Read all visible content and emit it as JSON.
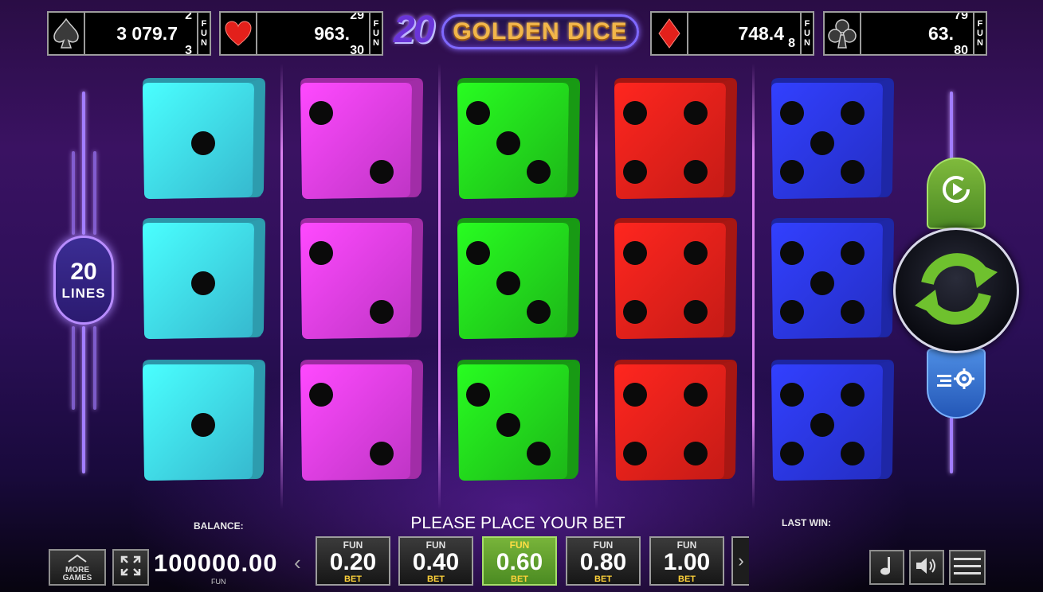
{
  "jackpots": [
    {
      "suit": "spade",
      "icon": "spade-icon",
      "value": "3 079.7",
      "roll_top": "2",
      "roll_bottom": "3",
      "fun": "FUN"
    },
    {
      "suit": "heart",
      "icon": "heart-icon",
      "value": "963.",
      "roll_top": "29",
      "roll_bottom": "30",
      "fun": "FUN"
    },
    {
      "suit": "diamond",
      "icon": "diamond-icon",
      "value": "748.4",
      "roll_top": "",
      "roll_bottom": "8",
      "fun": "FUN"
    },
    {
      "suit": "club",
      "icon": "club-icon",
      "value": "63.",
      "roll_top": "79",
      "roll_bottom": "80",
      "fun": "FUN"
    }
  ],
  "logo": {
    "number": "20",
    "text": "GOLDEN DICE"
  },
  "lines": {
    "count": "20",
    "label": "LINES"
  },
  "reels": [
    {
      "color": "#3fd8f2",
      "faces": [
        1,
        1,
        1
      ]
    },
    {
      "color": "#e03ee8",
      "faces": [
        2,
        2,
        2
      ]
    },
    {
      "color": "#22d61c",
      "faces": [
        3,
        3,
        3
      ]
    },
    {
      "color": "#e8201a",
      "faces": [
        4,
        4,
        4
      ]
    },
    {
      "color": "#2a36e6",
      "faces": [
        5,
        5,
        5
      ]
    }
  ],
  "bottom": {
    "balance_label": "BALANCE:",
    "balance_value": "100000.00",
    "balance_unit": "FUN",
    "message": "PLEASE PLACE YOUR BET",
    "last_win_label": "LAST WIN:",
    "more_games": "MORE GAMES",
    "bets": [
      {
        "fun": "FUN",
        "value": "0.20",
        "label": "BET",
        "active": false
      },
      {
        "fun": "FUN",
        "value": "0.40",
        "label": "BET",
        "active": false
      },
      {
        "fun": "FUN",
        "value": "0.60",
        "label": "BET",
        "active": true
      },
      {
        "fun": "FUN",
        "value": "0.80",
        "label": "BET",
        "active": false
      },
      {
        "fun": "FUN",
        "value": "1.00",
        "label": "BET",
        "active": false
      }
    ]
  }
}
